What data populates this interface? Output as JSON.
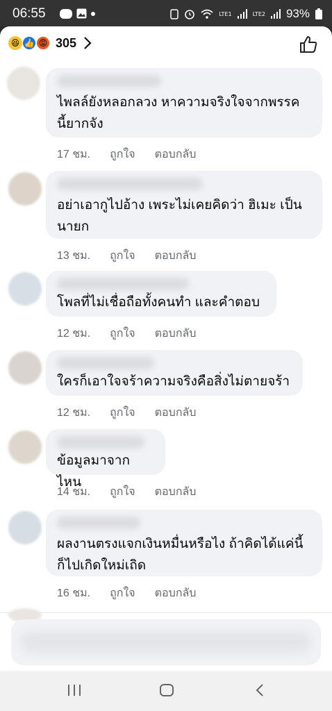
{
  "status": {
    "time": "06:55",
    "battery": "93%",
    "net1": "LTE1",
    "net2": "LTE2"
  },
  "reactions": {
    "count": "305",
    "icons": [
      "haha-icon",
      "like-icon",
      "angry-icon"
    ]
  },
  "comments": [
    {
      "text_lines": [
        "ไพลล์ยังหลอกลวง หาความจริงใจจากพรรค",
        "นี้ยากจัง"
      ],
      "time": "17 ชม.",
      "like": "ถูกใจ",
      "reply": "ตอบกลับ"
    },
    {
      "text_lines": [
        "อย่าเอากูไปอ้าง เพระไม่เคยคิดว่า ฮิเมะ เป็น",
        "นายก"
      ],
      "time": "13 ชม.",
      "like": "ถูกใจ",
      "reply": "ตอบกลับ"
    },
    {
      "text_lines": [
        "โพลที่ไม่เชื่อถือทั้งคนทำ และคำตอบ"
      ],
      "time": "12 ชม.",
      "like": "ถูกใจ",
      "reply": "ตอบกลับ"
    },
    {
      "text_lines": [
        "ใครก็เอาใจจร้าความจริงคือสิ่งไม่ตายจร้า"
      ],
      "time": "12 ชม.",
      "like": "ถูกใจ",
      "reply": "ตอบกลับ"
    },
    {
      "text_lines": [
        "ข้อมูลมาจากไหน"
      ],
      "time": "14 ชม.",
      "like": "ถูกใจ",
      "reply": "ตอบกลับ"
    },
    {
      "text_lines": [
        "ผลงานตรงแจกเงินหมื่นหรือไง ถ้าคิดได้แค่นี้",
        "ก็ไปเกิดใหม่เถิด"
      ],
      "time": "16 ชม.",
      "like": "ถูกใจ",
      "reply": "ตอบกลับ"
    }
  ],
  "nav": {
    "recent": "|||",
    "home": "○",
    "back": "<"
  }
}
